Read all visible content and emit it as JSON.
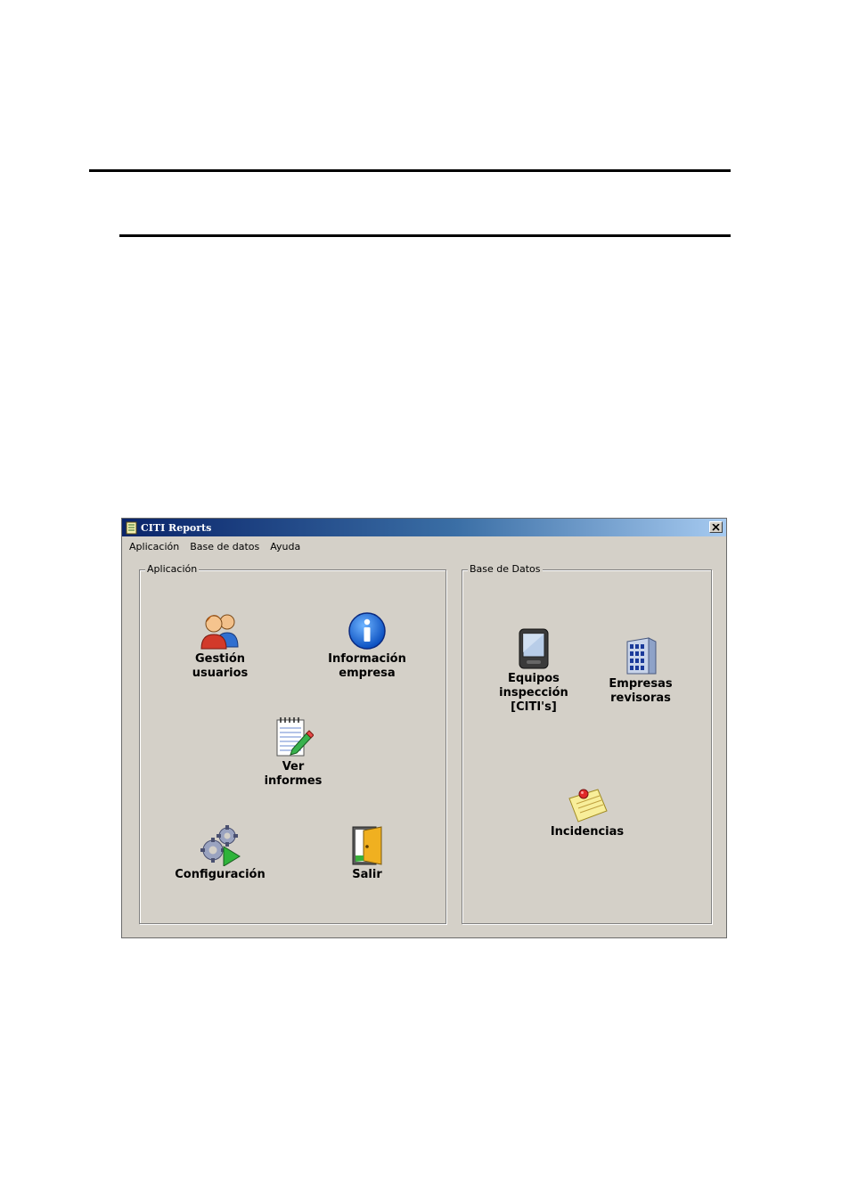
{
  "window": {
    "title": "CITI Reports",
    "close_label": "×"
  },
  "menu": {
    "items": [
      "Aplicación",
      "Base de datos",
      "Ayuda"
    ]
  },
  "groups": {
    "aplicacion": {
      "legend": "Aplicación",
      "buttons": {
        "gestion_usuarios": "Gestión\nusuarios",
        "informacion_empresa": "Información\nempresa",
        "ver_informes": "Ver\ninformes",
        "configuracion": "Configuración",
        "salir": "Salir"
      }
    },
    "base_datos": {
      "legend": "Base de Datos",
      "buttons": {
        "equipos": "Equipos\ninspección\n[CITI's]",
        "empresas": "Empresas\nrevisoras",
        "incidencias": "Incidencias"
      }
    }
  },
  "icons": {
    "users": "users-icon",
    "info": "info-icon",
    "reports": "notepad-pencil-icon",
    "config": "gears-icon",
    "exit": "door-icon",
    "devices": "pda-icon",
    "companies": "building-icon",
    "incidents": "sticky-note-icon",
    "app": "app-icon"
  },
  "colors": {
    "title_start": "#0a246a",
    "title_end": "#a6caf0",
    "window_bg": "#d4d0c8"
  }
}
